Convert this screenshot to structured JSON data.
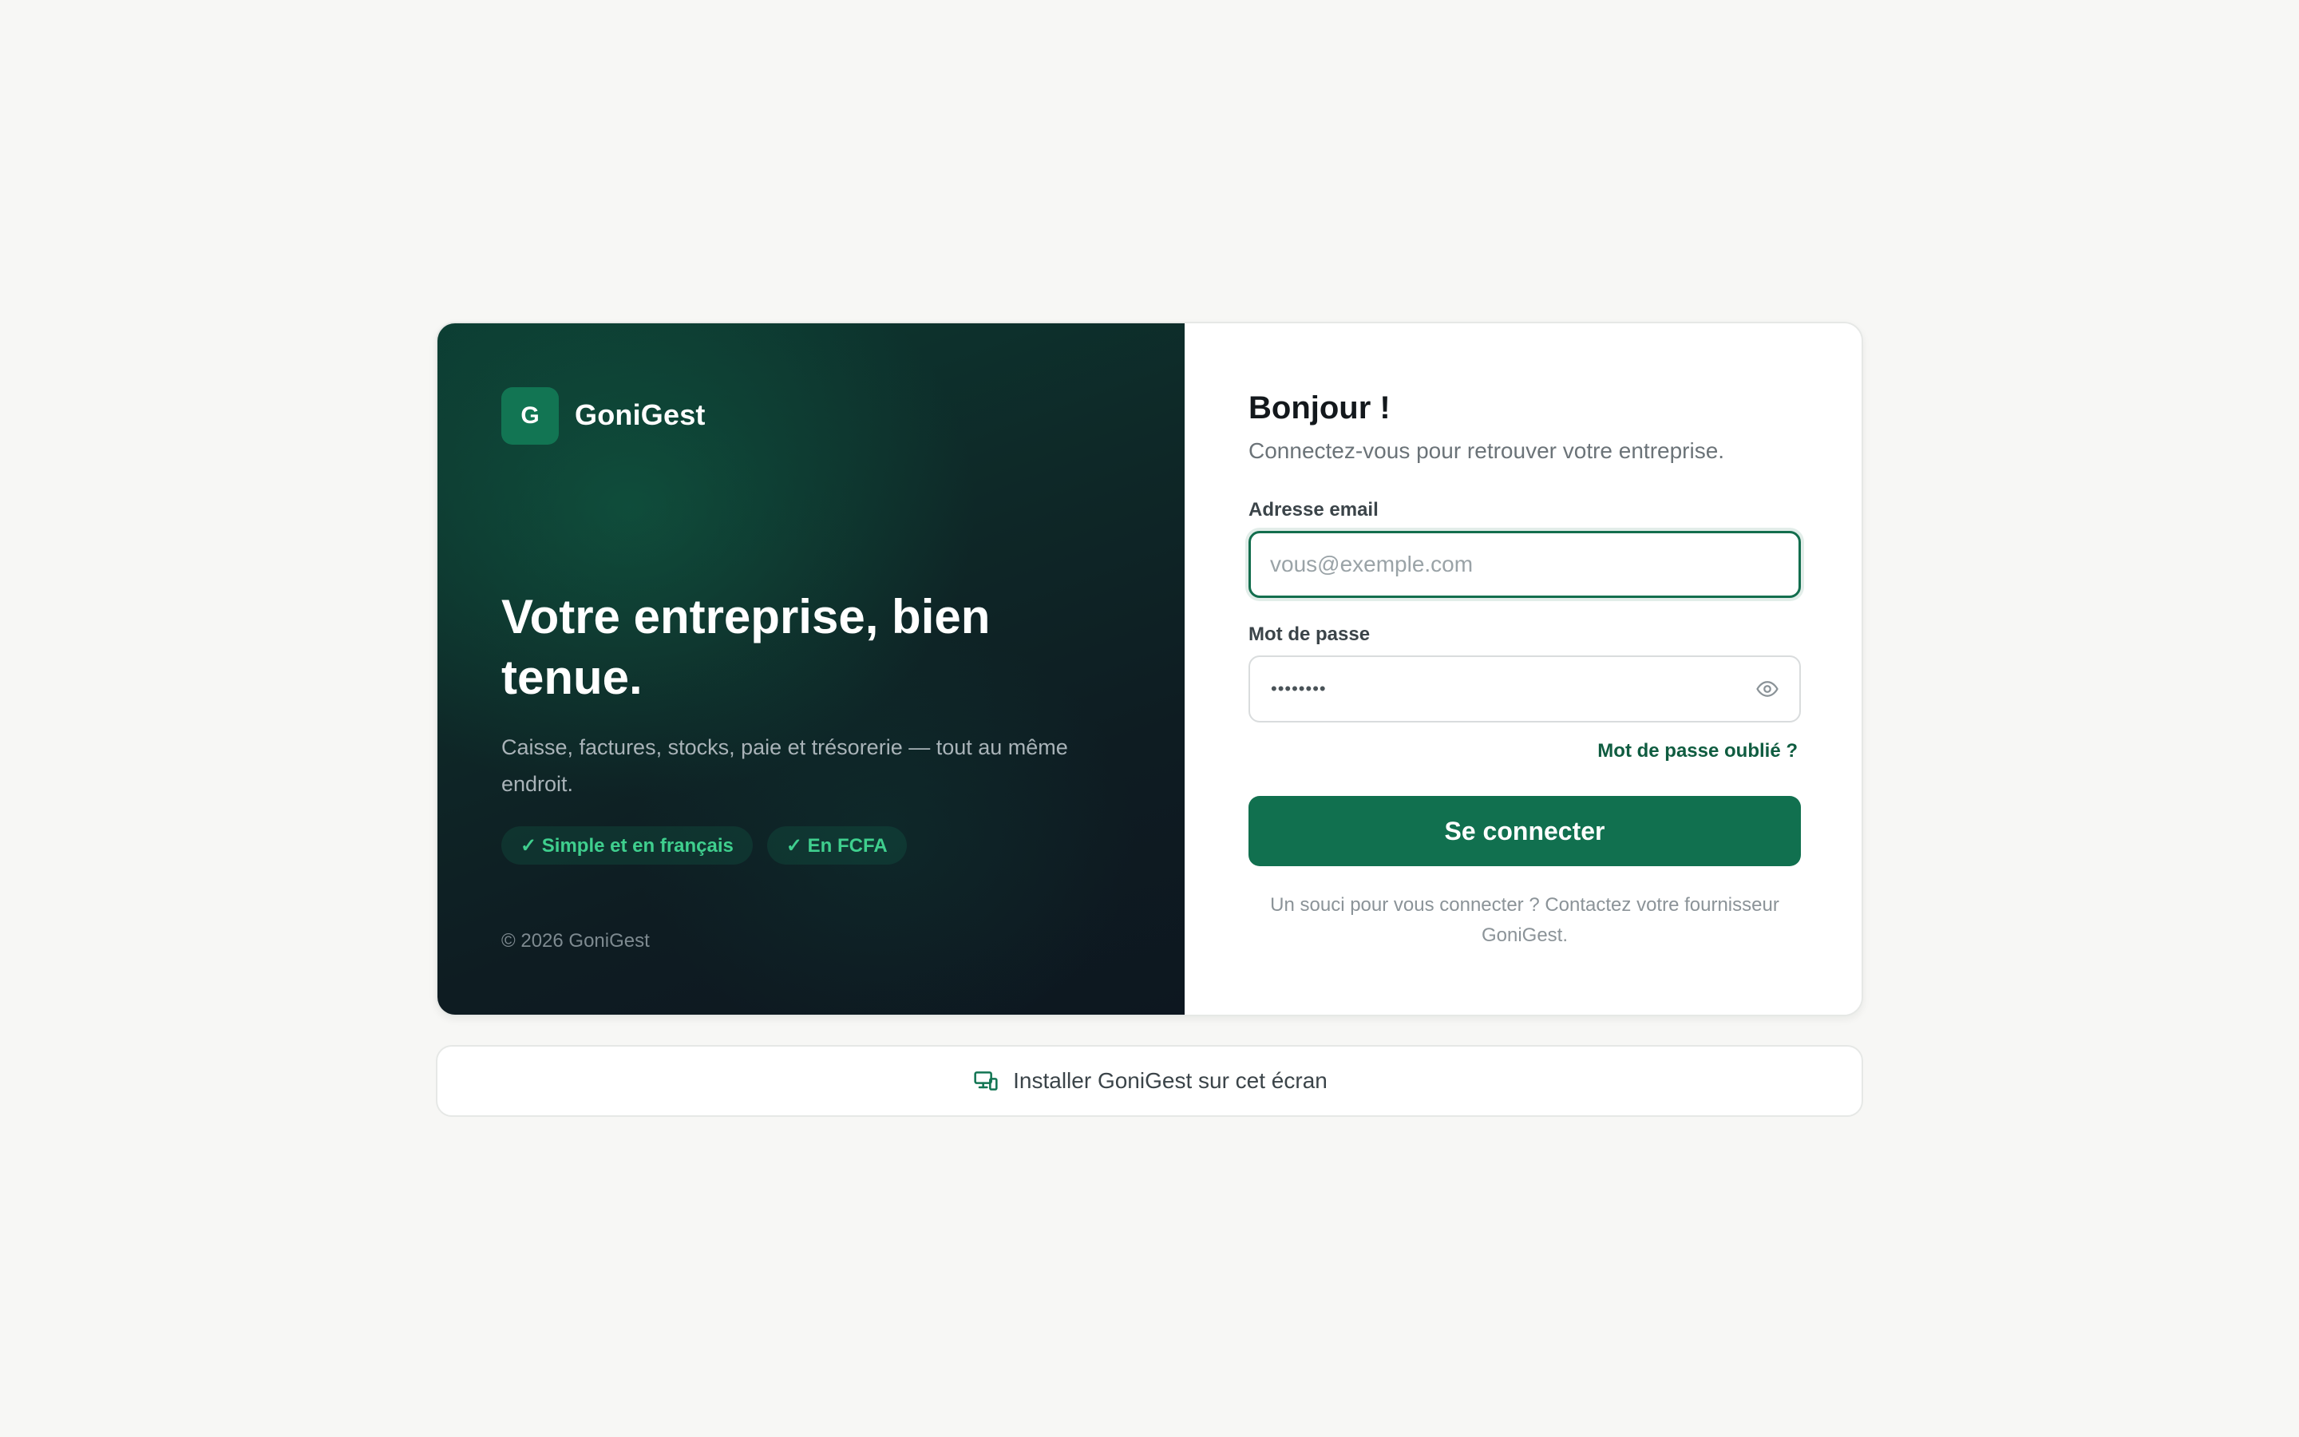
{
  "brand": {
    "logo_letter": "G",
    "name": "GoniGest",
    "hero_title": "Votre entreprise, bien tenue.",
    "hero_subtitle": "Caisse, factures, stocks, paie et trésorerie — tout au même endroit.",
    "tags": [
      "✓ Simple et en français",
      "✓ En FCFA"
    ],
    "copyright": "© 2026 GoniGest"
  },
  "login": {
    "greeting": "Bonjour !",
    "subtitle": "Connectez-vous pour retrouver votre entreprise.",
    "email": {
      "label": "Adresse email",
      "placeholder": "vous@exemple.com",
      "value": ""
    },
    "password": {
      "label": "Mot de passe",
      "masked_value": "••••••••",
      "toggle_icon": "eye-icon"
    },
    "forgot_link": "Mot de passe oublié ?",
    "submit_label": "Se connecter",
    "help_text": "Un souci pour vous connecter ? Contactez votre fournisseur GoniGest."
  },
  "install": {
    "icon": "devices-icon",
    "label": "Installer GoniGest sur cet écran"
  },
  "colors": {
    "page_background": "#f7f7f5",
    "brand_green": "#11704f",
    "brand_dark": "#0d1720",
    "tag_text": "#3fcf8e",
    "link": "#0f5c40"
  }
}
